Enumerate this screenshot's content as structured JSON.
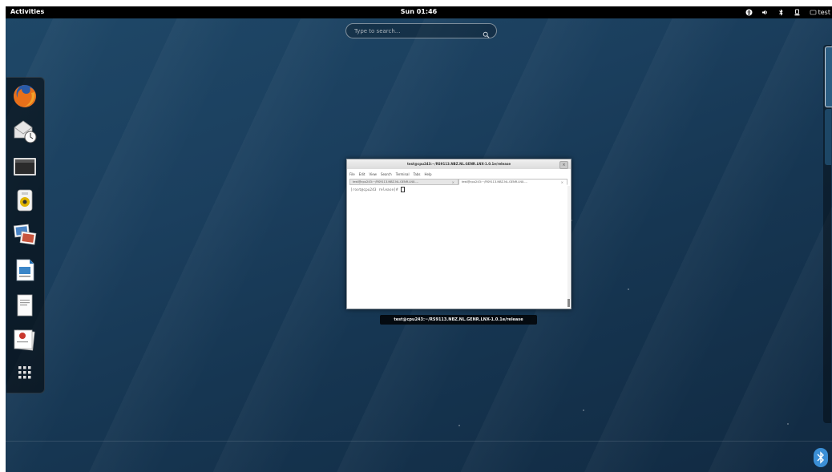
{
  "topbar": {
    "activities_label": "Activities",
    "clock": "Sun 01:46",
    "user_label": "test",
    "tray_icons": [
      "accessibility-icon",
      "volume-icon",
      "bluetooth-icon",
      "power-icon",
      "user-icon"
    ]
  },
  "search": {
    "placeholder": "Type to search..."
  },
  "dash": {
    "items": [
      {
        "name": "firefox-icon"
      },
      {
        "name": "evolution-mail-icon"
      },
      {
        "name": "terminal-icon"
      },
      {
        "name": "rhythmbox-icon"
      },
      {
        "name": "shotwell-icon"
      },
      {
        "name": "libreoffice-writer-icon"
      },
      {
        "name": "document-viewer-icon"
      },
      {
        "name": "software-install-icon"
      },
      {
        "name": "show-applications-icon"
      }
    ]
  },
  "terminal": {
    "title": "test@cpu243:~/RS9113.NBZ.NL.GENR.LNX-1.0.1e/release",
    "menu": [
      "File",
      "Edit",
      "View",
      "Search",
      "Terminal",
      "Tabs",
      "Help"
    ],
    "tabs": [
      {
        "label": "test@cpu243:~/RS9113.NBZ.NL.GENR.LNX-...",
        "active": false
      },
      {
        "label": "test@cpu243:~/RS9113.NBZ.NL.GENR.LNX-...",
        "active": true
      }
    ],
    "prompt": "[root@cpu243 release]# "
  },
  "window_caption": "test@cpu243:~/RS9113.NBZ.NL.GENR.LNX-1.0.1e/release",
  "colors": {
    "topbar": "#000000",
    "wallpaper": "#1b3f5e"
  }
}
